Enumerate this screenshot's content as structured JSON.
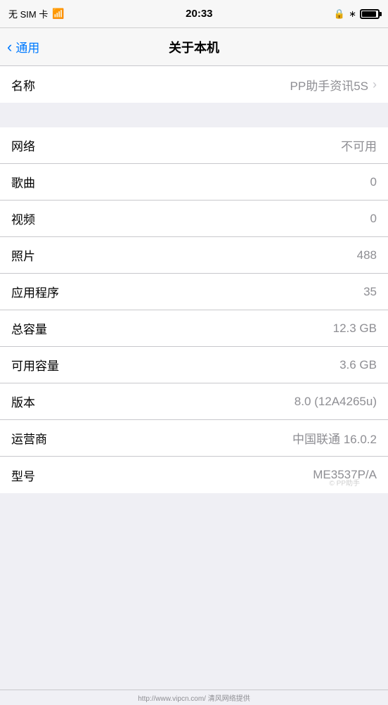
{
  "statusBar": {
    "carrier": "无 SIM 卡",
    "time": "20:33",
    "lockLabel": "lock",
    "bluetoothLabel": "bluetooth",
    "batteryLabel": "battery"
  },
  "navBar": {
    "backLabel": "通用",
    "title": "关于本机"
  },
  "rows": [
    {
      "label": "名称",
      "value": "PP助手资讯5S",
      "hasChevron": true,
      "id": "name"
    },
    {
      "label": "网络",
      "value": "不可用",
      "hasChevron": false,
      "id": "network"
    },
    {
      "label": "歌曲",
      "value": "0",
      "hasChevron": false,
      "id": "songs"
    },
    {
      "label": "视频",
      "value": "0",
      "hasChevron": false,
      "id": "videos"
    },
    {
      "label": "照片",
      "value": "488",
      "hasChevron": false,
      "id": "photos"
    },
    {
      "label": "应用程序",
      "value": "35",
      "hasChevron": false,
      "id": "apps"
    },
    {
      "label": "总容量",
      "value": "12.3 GB",
      "hasChevron": false,
      "id": "total-capacity"
    },
    {
      "label": "可用容量",
      "value": "3.6 GB",
      "hasChevron": false,
      "id": "available-capacity"
    },
    {
      "label": "版本",
      "value": "8.0 (12A4265u)",
      "hasChevron": false,
      "id": "version"
    },
    {
      "label": "运营商",
      "value": "中国联通 16.0.2",
      "hasChevron": false,
      "id": "carrier"
    },
    {
      "label": "型号",
      "value": "ME3537P/A",
      "hasChevron": false,
      "id": "model"
    }
  ],
  "watermark": "© PP助手",
  "urlText": "http://www.vipcn.com/ 清风网络提供"
}
